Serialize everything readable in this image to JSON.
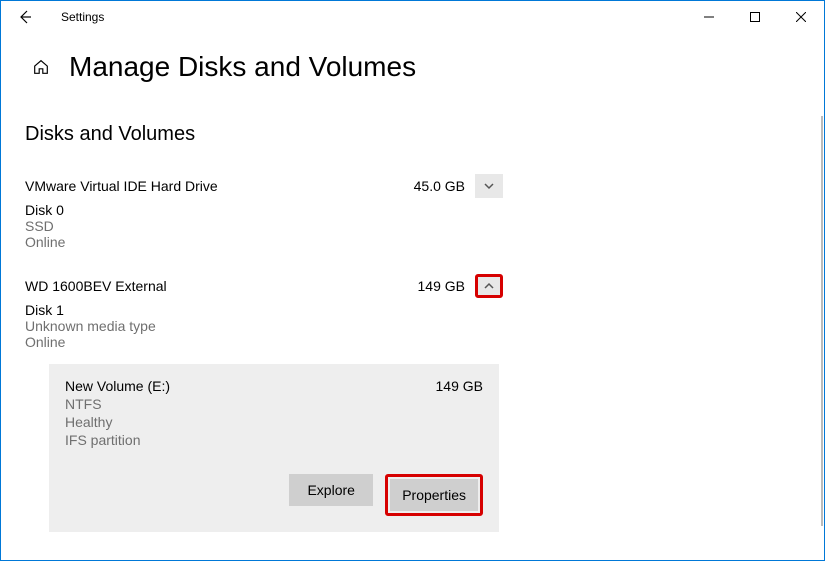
{
  "window": {
    "title": "Settings"
  },
  "header": {
    "title": "Manage Disks and Volumes"
  },
  "section": {
    "title": "Disks and Volumes"
  },
  "disks": [
    {
      "name": "VMware Virtual IDE Hard Drive",
      "size": "45.0 GB",
      "label": "Disk 0",
      "media": "SSD",
      "status": "Online"
    },
    {
      "name": "WD 1600BEV External",
      "size": "149 GB",
      "label": "Disk 1",
      "media": "Unknown media type",
      "status": "Online"
    }
  ],
  "volume": {
    "name": "New Volume (E:)",
    "size": "149 GB",
    "fs": "NTFS",
    "health": "Healthy",
    "partition": "IFS partition"
  },
  "actions": {
    "explore": "Explore",
    "properties": "Properties"
  }
}
